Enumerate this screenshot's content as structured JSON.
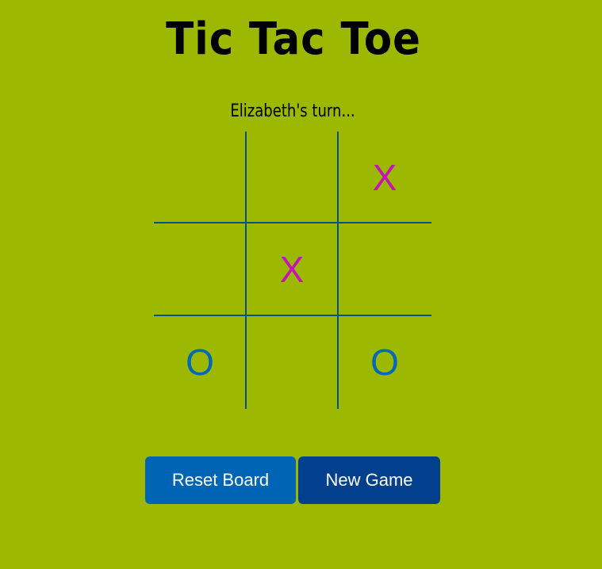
{
  "title": "Tic Tac Toe",
  "status": "Elizabeth's turn...",
  "colors": {
    "background": "#9db800",
    "grid": "#0b4f8a",
    "x_mark": "#c414b4",
    "o_mark": "#0068b8",
    "reset_button": "#0064b4",
    "new_game_button": "#023f8c"
  },
  "board": {
    "cells": [
      "",
      "",
      "X",
      "",
      "X",
      "",
      "O",
      "",
      "O"
    ]
  },
  "buttons": {
    "reset_label": "Reset Board",
    "new_game_label": "New Game"
  }
}
